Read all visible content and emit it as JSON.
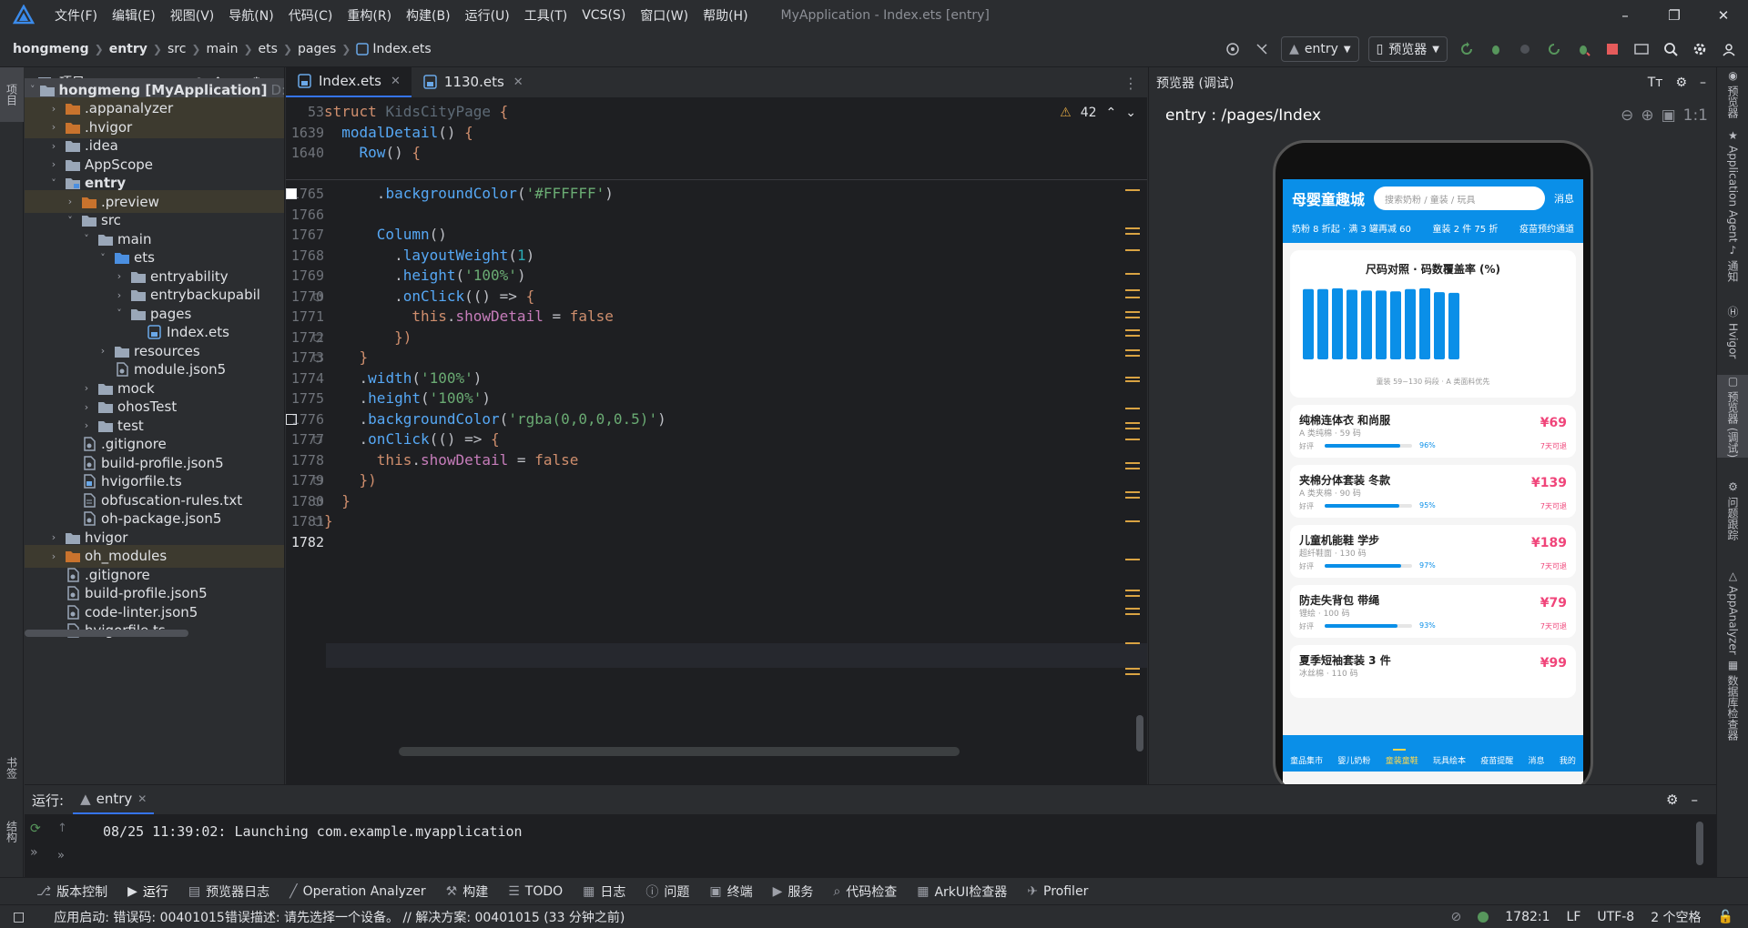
{
  "window": {
    "menu": [
      "文件(F)",
      "编辑(E)",
      "视图(V)",
      "导航(N)",
      "代码(C)",
      "重构(R)",
      "构建(B)",
      "运行(U)",
      "工具(T)",
      "VCS(S)",
      "窗口(W)",
      "帮助(H)"
    ],
    "title": "MyApplication - Index.ets [entry]"
  },
  "navbar": {
    "breadcrumbs": [
      "hongmeng",
      "entry",
      "src",
      "main",
      "ets",
      "pages",
      "Index.ets"
    ],
    "run_config": "entry",
    "device": "预览器"
  },
  "left_strip": {
    "project_tab": "项目",
    "bookmarks_tab": "书签",
    "structure_tab": "结构"
  },
  "project": {
    "header": "项目",
    "root_extra": "D:",
    "tree": [
      {
        "label": "hongmeng [MyApplication]",
        "depth": 0,
        "arrow": "down",
        "icon": "folder",
        "bold": true,
        "state": "sel"
      },
      {
        "label": ".appanalyzer",
        "depth": 1,
        "arrow": "right",
        "icon": "folder-orange",
        "state": "hl"
      },
      {
        "label": ".hvigor",
        "depth": 1,
        "arrow": "right",
        "icon": "folder-orange",
        "state": "hl"
      },
      {
        "label": ".idea",
        "depth": 1,
        "arrow": "right",
        "icon": "folder"
      },
      {
        "label": "AppScope",
        "depth": 1,
        "arrow": "right",
        "icon": "folder"
      },
      {
        "label": "entry",
        "depth": 1,
        "arrow": "down",
        "icon": "folder-module",
        "bold": true
      },
      {
        "label": ".preview",
        "depth": 2,
        "arrow": "right",
        "icon": "folder-orange",
        "state": "hl"
      },
      {
        "label": "src",
        "depth": 2,
        "arrow": "down",
        "icon": "folder"
      },
      {
        "label": "main",
        "depth": 3,
        "arrow": "down",
        "icon": "folder"
      },
      {
        "label": "ets",
        "depth": 4,
        "arrow": "down",
        "icon": "folder-blue"
      },
      {
        "label": "entryability",
        "depth": 5,
        "arrow": "right",
        "icon": "folder"
      },
      {
        "label": "entrybackupabil",
        "depth": 5,
        "arrow": "right",
        "icon": "folder"
      },
      {
        "label": "pages",
        "depth": 5,
        "arrow": "down",
        "icon": "folder"
      },
      {
        "label": "Index.ets",
        "depth": 6,
        "arrow": "",
        "icon": "ets-file"
      },
      {
        "label": "resources",
        "depth": 4,
        "arrow": "right",
        "icon": "folder"
      },
      {
        "label": "module.json5",
        "depth": 4,
        "arrow": "",
        "icon": "json-file"
      },
      {
        "label": "mock",
        "depth": 3,
        "arrow": "right",
        "icon": "folder"
      },
      {
        "label": "ohosTest",
        "depth": 3,
        "arrow": "right",
        "icon": "folder"
      },
      {
        "label": "test",
        "depth": 3,
        "arrow": "right",
        "icon": "folder"
      },
      {
        "label": ".gitignore",
        "depth": 2,
        "arrow": "",
        "icon": "json-file"
      },
      {
        "label": "build-profile.json5",
        "depth": 2,
        "arrow": "",
        "icon": "json-file"
      },
      {
        "label": "hvigorfile.ts",
        "depth": 2,
        "arrow": "",
        "icon": "ts-file"
      },
      {
        "label": "obfuscation-rules.txt",
        "depth": 2,
        "arrow": "",
        "icon": "txt-file"
      },
      {
        "label": "oh-package.json5",
        "depth": 2,
        "arrow": "",
        "icon": "json-file"
      },
      {
        "label": "hvigor",
        "depth": 1,
        "arrow": "right",
        "icon": "folder"
      },
      {
        "label": "oh_modules",
        "depth": 1,
        "arrow": "right",
        "icon": "folder-orange",
        "state": "hl"
      },
      {
        "label": ".gitignore",
        "depth": 1,
        "arrow": "",
        "icon": "json-file"
      },
      {
        "label": "build-profile.json5",
        "depth": 1,
        "arrow": "",
        "icon": "json-file"
      },
      {
        "label": "code-linter.json5",
        "depth": 1,
        "arrow": "",
        "icon": "json-file"
      },
      {
        "label": "hvigorfile.ts",
        "depth": 1,
        "arrow": "",
        "icon": "ts-file"
      }
    ]
  },
  "editor": {
    "tabs": [
      {
        "label": "Index.ets",
        "active": true
      },
      {
        "label": "1130.ets",
        "active": false
      }
    ],
    "warnings": "42",
    "sticky": [
      {
        "ln": "53",
        "html": "<span class='kw'>struct</span> <span class='dim'>KidsCityPage</span> <span class='kw'>{</span>"
      },
      {
        "ln": "1639",
        "html": "  <span class='fn'>modalDetail</span>() <span class='kw'>{</span>"
      },
      {
        "ln": "1640",
        "html": "    <span class='fn'>Row</span>() <span class='kw'>{</span>"
      }
    ],
    "lines": [
      {
        "ln": "1765",
        "html": "      .<span class='fn'>backgroundColor</span>(<span class='str'>'#FFFFFF'</span>)"
      },
      {
        "ln": "1766",
        "html": ""
      },
      {
        "ln": "1767",
        "html": "      <span class='fn'>Column</span>()"
      },
      {
        "ln": "1768",
        "html": "        .<span class='fn'>layoutWeight</span>(<span class='num'>1</span>)"
      },
      {
        "ln": "1769",
        "html": "        .<span class='fn'>height</span>(<span class='str'>'100%'</span>)"
      },
      {
        "ln": "1770",
        "html": "        .<span class='fn'>onClick</span>(() => <span class='kw'>{</span>"
      },
      {
        "ln": "1771",
        "html": "          <span class='thisk'>this</span>.<span class='prop'>showDetail</span> = <span class='bool'>false</span>"
      },
      {
        "ln": "1772",
        "html": "        <span class='kw'>})</span>"
      },
      {
        "ln": "1773",
        "html": "    <span class='kw'>}</span>"
      },
      {
        "ln": "1774",
        "html": "    .<span class='fn'>width</span>(<span class='str'>'100%'</span>)"
      },
      {
        "ln": "1775",
        "html": "    .<span class='fn'>height</span>(<span class='str'>'100%'</span>)"
      },
      {
        "ln": "1776",
        "html": "    .<span class='fn'>backgroundColor</span>(<span class='str'>'rgba(0,0,0,0.5)'</span>)"
      },
      {
        "ln": "1777",
        "html": "    .<span class='fn'>onClick</span>(() => <span class='kw'>{</span>"
      },
      {
        "ln": "1778",
        "html": "      <span class='thisk'>this</span>.<span class='prop'>showDetail</span> = <span class='bool'>false</span>"
      },
      {
        "ln": "1779",
        "html": "    <span class='kw'>})</span>"
      },
      {
        "ln": "1780",
        "html": "  <span class='kw'>}</span>"
      },
      {
        "ln": "1781",
        "html": "<span class='kw'>}</span>"
      },
      {
        "ln": "1782",
        "html": ""
      }
    ]
  },
  "preview": {
    "header": "预览器 (调试)",
    "path": "entry : /pages/Index",
    "app": {
      "title": "母婴童趣城",
      "search_placeholder": "搜索奶粉 / 童装 / 玩具",
      "msg": "消息",
      "promos": [
        "奶粉 8 折起 · 满 3 罐再减 60",
        "童装 2 件 75 折",
        "疫苗预约通道"
      ],
      "chart_title": "尺码对照 · 码数覆盖率 (%)",
      "chart_caption": "童装 59~130 码段 · A 类面料优先",
      "products": [
        {
          "name": "纯棉连体衣 和尚服",
          "meta": "A 类纯棉 · 59 码",
          "price": "¥69",
          "good": "好评",
          "pct": "96%",
          "pct_value": 96,
          "ret": "7天可退"
        },
        {
          "name": "夹棉分体套装 冬款",
          "meta": "A 类夹棉 · 90 码",
          "price": "¥139",
          "good": "好评",
          "pct": "95%",
          "pct_value": 95,
          "ret": "7天可退"
        },
        {
          "name": "儿童机能鞋 学步",
          "meta": "超纤鞋面 · 130 码",
          "price": "¥189",
          "good": "好评",
          "pct": "97%",
          "pct_value": 97,
          "ret": "7天可退"
        },
        {
          "name": "防走失背包 带绳",
          "meta": "锂绘 · 100 码",
          "price": "¥79",
          "good": "好评",
          "pct": "93%",
          "pct_value": 93,
          "ret": "7天可退"
        },
        {
          "name": "夏季短袖套装 3 件",
          "meta": "冰丝棉 · 110 码",
          "price": "¥99",
          "good": "",
          "pct": "",
          "ret": ""
        }
      ],
      "nav": [
        {
          "label": "童品集市",
          "active": false
        },
        {
          "label": "婴儿奶粉",
          "active": false
        },
        {
          "label": "童装童鞋",
          "active": true
        },
        {
          "label": "玩具绘本",
          "active": false
        },
        {
          "label": "疫苗提醒",
          "active": false
        },
        {
          "label": "消息",
          "active": false
        },
        {
          "label": "我的",
          "active": false
        }
      ]
    }
  },
  "chart_data": {
    "type": "bar",
    "title": "尺码对照 · 码数覆盖率 (%)",
    "values": [
      92,
      92,
      93,
      91,
      90,
      90,
      89,
      92,
      93,
      88,
      87
    ],
    "ylim": [
      0,
      100
    ],
    "color": "#0a8fe8"
  },
  "right_strip": [
    "预览器",
    "Application Agent",
    "通知",
    "Hvigor",
    "预览器 (调试)",
    "问题跟踪",
    "AppAnalyzer",
    "数据库检查器"
  ],
  "run": {
    "label": "运行:",
    "tab": "entry",
    "log": "08/25 11:39:02: Launching com.example.myapplication"
  },
  "tooltabs": [
    "版本控制",
    "运行",
    "预览器日志",
    "Operation Analyzer",
    "构建",
    "TODO",
    "日志",
    "问题",
    "终端",
    "服务",
    "代码检查",
    "ArkUI检查器",
    "Profiler"
  ],
  "status": {
    "message": "应用启动: 错误码: 00401015错误描述: 请先选择一个设备。 // 解决方案: 00401015 (33 分钟之前)",
    "position": "1782:1",
    "line_sep": "LF",
    "encoding": "UTF-8",
    "indent": "2 个空格"
  }
}
